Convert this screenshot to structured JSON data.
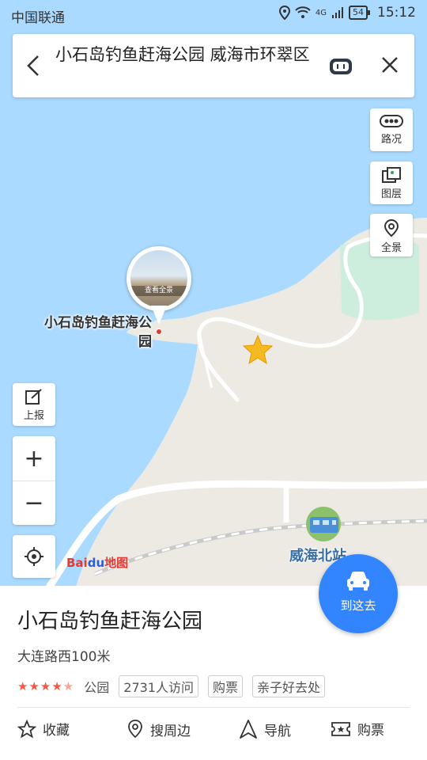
{
  "status_bar": {
    "carrier": "中国联通",
    "battery": "54",
    "time": "15:12",
    "network": "4G"
  },
  "search": {
    "query": "小石岛钓鱼赶海公园 威海市环翠区"
  },
  "map_controls": {
    "traffic": "路况",
    "layers": "图层",
    "panorama": "全景",
    "report": "上报",
    "zoom_in": "+",
    "zoom_out": "−"
  },
  "map": {
    "pin_label": "小石岛钓鱼赶海公园",
    "pano_caption": "查看全景",
    "station_label": "威海北站",
    "logo_bai": "Bai",
    "logo_du": "du",
    "logo_map": "地图",
    "colors": {
      "sea": "#aadaff",
      "land": "#eceae3",
      "green": "#cdeedd",
      "road": "#ffffff"
    }
  },
  "go_button": {
    "label": "到这去"
  },
  "place": {
    "name": "小石岛钓鱼赶海公园",
    "address": "大连路西100米",
    "rating_stars": 4.5,
    "category": "公园",
    "visits": "2731人访问",
    "tags": [
      "购票",
      "亲子好去处"
    ]
  },
  "actions": [
    {
      "label": "收藏",
      "icon": "star-outline-icon"
    },
    {
      "label": "搜周边",
      "icon": "location-search-icon"
    },
    {
      "label": "导航",
      "icon": "navigation-arrow-icon"
    },
    {
      "label": "购票",
      "icon": "ticket-icon"
    }
  ],
  "accent_color": "#3385ff"
}
